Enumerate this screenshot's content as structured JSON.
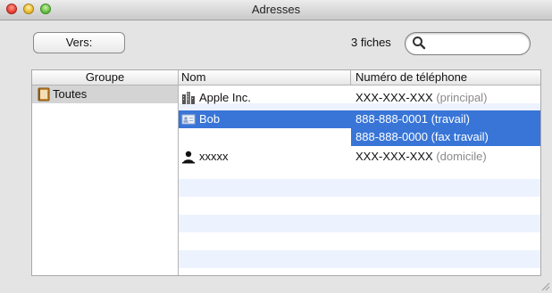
{
  "window": {
    "title": "Adresses"
  },
  "toolbar": {
    "to_button_label": "Vers:",
    "count_label": "3 fiches",
    "search": {
      "value": "",
      "placeholder": ""
    }
  },
  "table": {
    "headers": {
      "group": "Groupe",
      "name": "Nom",
      "phone": "Numéro de téléphone"
    },
    "groups": [
      {
        "label": "Toutes",
        "icon": "address-book-icon",
        "selected": true
      }
    ],
    "contacts": [
      {
        "name": "Apple Inc.",
        "icon": "company-icon",
        "phones": [
          {
            "number": "XXX-XXX-XXX",
            "type": "(principal)"
          }
        ]
      },
      {
        "name": "Bob",
        "icon": "vcard-icon",
        "selected": true,
        "phones": [
          {
            "number": "888-888-0001",
            "type": "(travail)"
          },
          {
            "number": "888-888-0000",
            "type": "(fax travail)",
            "selected": true
          }
        ]
      },
      {
        "name": "xxxxx",
        "icon": "person-icon",
        "phones": [
          {
            "number": "XXX-XXX-XXX",
            "type": "(domicile)"
          }
        ]
      }
    ]
  },
  "colors": {
    "selection": "#3875d7",
    "stripe": "#edf3fe",
    "group_selection": "#d4d4d4",
    "secondary_text": "#8a8a8a"
  }
}
